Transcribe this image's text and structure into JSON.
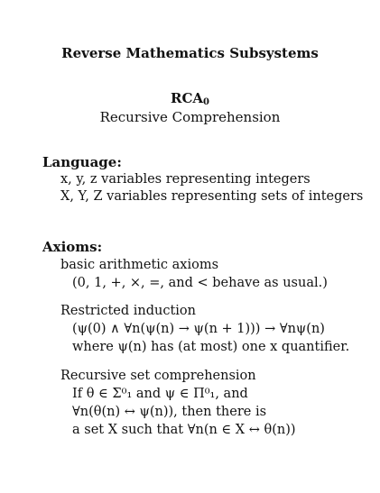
{
  "title": "Reverse Mathematics Subsystems",
  "system": {
    "name": "RCA",
    "subscript": "0",
    "description": "Recursive Comprehension"
  },
  "language": {
    "heading": "Language:",
    "lines": [
      "x, y, z variables representing integers",
      "X, Y, Z variables representing sets of integers"
    ]
  },
  "axioms": {
    "heading": "Axioms:",
    "arithmetic": {
      "title": "basic arithmetic axioms",
      "detail": "(0, 1, +, ×, =, and < behave as usual.)"
    },
    "induction": {
      "title": "Restricted induction",
      "formula": "(ψ(0) ∧ ∀n(ψ(n) → ψ(n + 1))) → ∀nψ(n)",
      "condition": "where ψ(n) has (at most) one x quantifier."
    },
    "comprehension": {
      "title": "Recursive set comprehension",
      "line1": "If θ ∈ Σ⁰₁ and ψ ∈ Π⁰₁, and",
      "line2": "∀n(θ(n) ↔ ψ(n)), then there is",
      "line3": "a set X such that ∀n(n ∈ X ↔ θ(n))"
    }
  }
}
